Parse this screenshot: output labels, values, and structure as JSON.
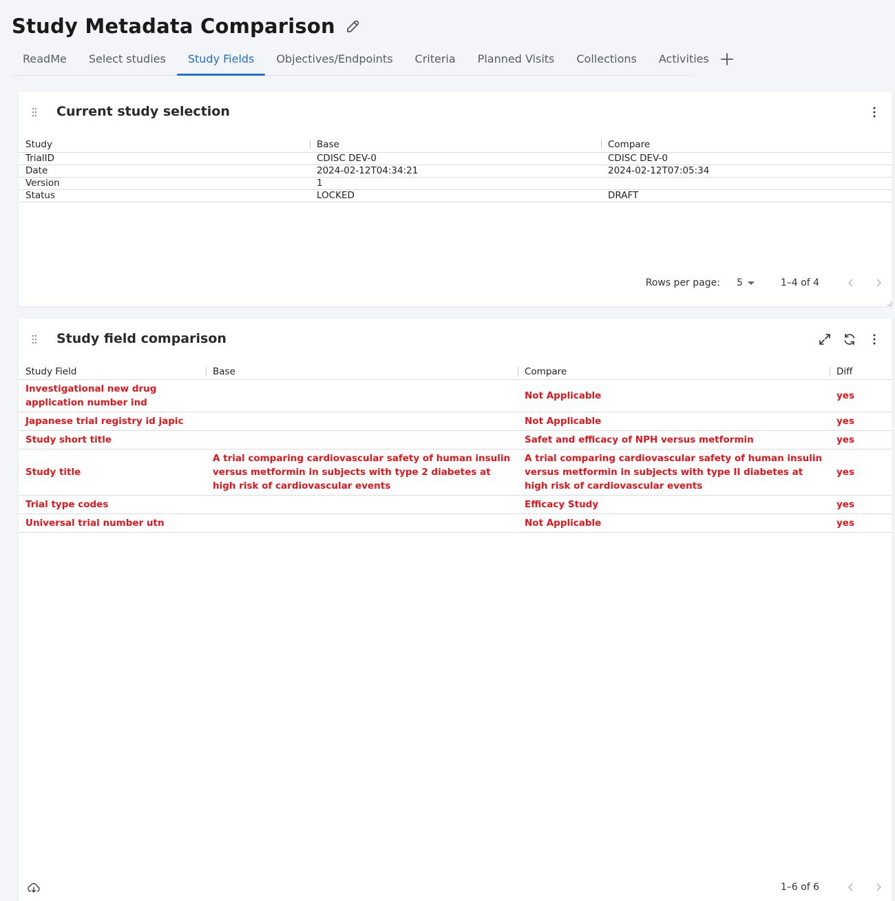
{
  "page": {
    "title": "Study Metadata Comparison",
    "edit_icon": "pencil-icon"
  },
  "tabs": [
    {
      "label": "ReadMe"
    },
    {
      "label": "Select studies"
    },
    {
      "label": "Study Fields",
      "active": true
    },
    {
      "label": "Objectives/Endpoints"
    },
    {
      "label": "Criteria"
    },
    {
      "label": "Planned Visits"
    },
    {
      "label": "Collections"
    },
    {
      "label": "Activities"
    }
  ],
  "add_tab_icon": "plus-icon",
  "selection_card": {
    "title": "Current study selection",
    "columns": [
      "Study",
      "Base",
      "Compare"
    ],
    "rows": [
      [
        "TrialID",
        "CDISC DEV-0",
        "CDISC DEV-0"
      ],
      [
        "Date",
        "2024-02-12T04:34:21",
        "2024-02-12T07:05:34"
      ],
      [
        "Version",
        "1",
        ""
      ],
      [
        "Status",
        "LOCKED",
        "DRAFT"
      ]
    ],
    "rows_per_page_label": "Rows per page:",
    "rows_per_page": "5",
    "range": "1–4 of 4"
  },
  "comparison_card": {
    "title": "Study field comparison",
    "columns": [
      "Study Field",
      "Base",
      "Compare",
      "Diff"
    ],
    "rows": [
      [
        "Investigational new drug application number ind",
        "",
        "Not Applicable",
        "yes"
      ],
      [
        "Japanese trial registry id japic",
        "",
        "Not Applicable",
        "yes"
      ],
      [
        "Study short title",
        "",
        "Safet and efficacy of NPH versus metformin",
        "yes"
      ],
      [
        "Study title",
        "A trial comparing cardiovascular safety of human insulin versus metformin in subjects with type 2 diabetes at high risk of cardiovascular events",
        "A trial comparing cardiovascular safety of human insulin versus metformin in subjects with type II diabetes at high risk of cardiovascular events",
        "yes"
      ],
      [
        "Trial type codes",
        "",
        "Efficacy Study",
        "yes"
      ],
      [
        "Universal trial number utn",
        "",
        "Not Applicable",
        "yes"
      ]
    ],
    "range": "1–6 of 6"
  },
  "colors": {
    "accent": "#1f6fd1",
    "diff_text": "#e0171b",
    "background": "#f4f5f8"
  }
}
